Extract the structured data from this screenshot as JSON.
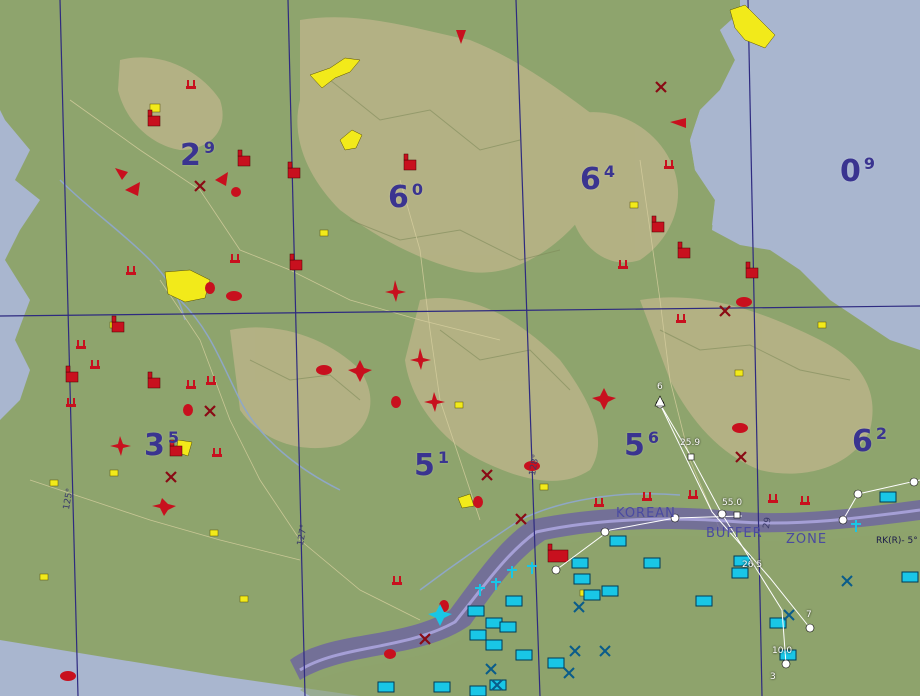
{
  "colors": {
    "sea": "#a9b6cf",
    "land": "#8ea46d",
    "highland": "#b9b487",
    "grid": "#2e2a80",
    "buffer_zone": "#6a5fa6",
    "enemy": "#c8101e",
    "friendly": "#19c6e6",
    "airfield": "#f2ea1a",
    "route": "#ffffff"
  },
  "regions": [
    {
      "id": "r29",
      "num": "2",
      "sup": "9"
    },
    {
      "id": "r60",
      "num": "6",
      "sup": "0"
    },
    {
      "id": "r64",
      "num": "6",
      "sup": "4"
    },
    {
      "id": "r09",
      "num": "0",
      "sup": "9"
    },
    {
      "id": "r35",
      "num": "3",
      "sup": "5"
    },
    {
      "id": "r51",
      "num": "5",
      "sup": "1"
    },
    {
      "id": "r56",
      "num": "5",
      "sup": "6"
    },
    {
      "id": "r62",
      "num": "6",
      "sup": "2"
    }
  ],
  "buffer_zone": {
    "korean": "KOREAN",
    "buffer": "BUFFER",
    "zone": "ZONE"
  },
  "route_labels": {
    "wp_a": "6",
    "wp_b": "25.9",
    "wp_c": "55.0",
    "wp_d": "26.5",
    "wp_e": "10.0",
    "wp_f": "7",
    "wp_g": "3"
  },
  "grid_labels": {
    "g1": "125°",
    "g2": "127°",
    "g3": "128°",
    "g4": "29",
    "g5": "RK(R)- 5°"
  },
  "icons": {
    "enemy_factory": "factory-icon",
    "enemy_sam": "sam-site-icon",
    "enemy_aircraft": "enemy-aircraft-icon",
    "enemy_destroyed": "destroyed-x-icon",
    "enemy_triangle": "enemy-flight-marker-icon",
    "friendly_unit": "friendly-unit-icon",
    "friendly_radar": "radar-icon",
    "airfield": "airfield-icon"
  }
}
